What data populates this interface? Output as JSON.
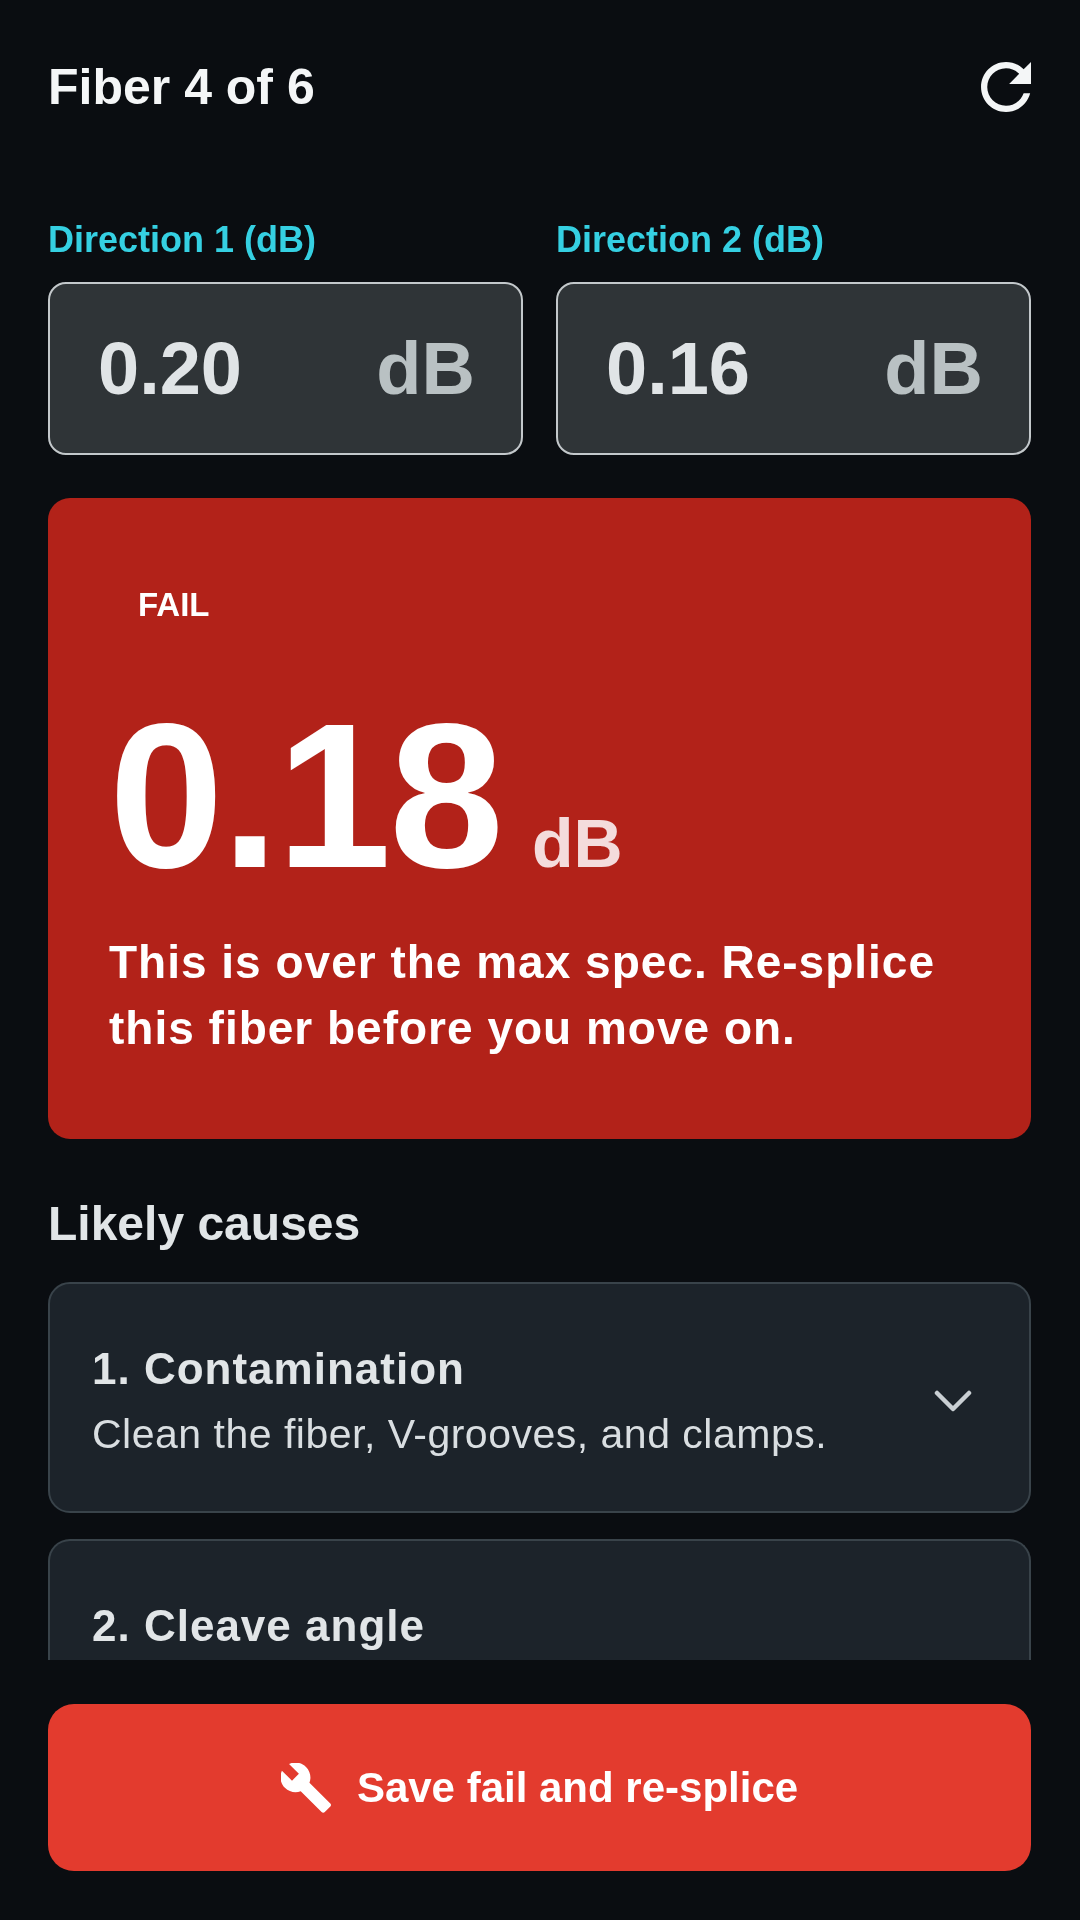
{
  "header": {
    "title": "Fiber 4 of 6"
  },
  "readings": [
    {
      "label": "Direction 1 (dB)",
      "value": "0.20",
      "unit": "dB"
    },
    {
      "label": "Direction 2 (dB)",
      "value": "0.16",
      "unit": "dB"
    }
  ],
  "result": {
    "passed": false,
    "badge": "FAIL",
    "value": "0.18",
    "unit": "dB",
    "message": "This is over the max spec. Re-splice this fiber before you move on."
  },
  "causes": {
    "title": "Likely causes",
    "items": [
      {
        "title": "1. Contamination",
        "description": "Clean the fiber, V-grooves, and clamps.",
        "expanded": false
      },
      {
        "title": "2. Cleave angle"
      }
    ]
  },
  "action_button": {
    "label": "Save fail and re-splice"
  }
}
